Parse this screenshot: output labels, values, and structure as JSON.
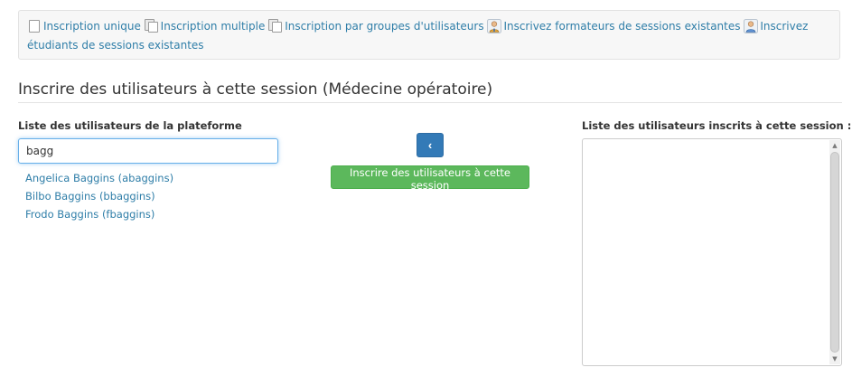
{
  "toolbar": {
    "links": [
      {
        "label": "Inscription unique",
        "icon": "single-user-document-icon"
      },
      {
        "label": "Inscription multiple",
        "icon": "multiple-documents-icon"
      },
      {
        "label": "Inscription par groupes d'utilisateurs",
        "icon": "group-documents-icon"
      },
      {
        "label": "Inscrivez formateurs de sessions existantes",
        "icon": "teacher-user-icon"
      },
      {
        "label": "Inscrivez étudiants de sessions existantes",
        "icon": "student-user-icon"
      }
    ]
  },
  "page": {
    "title": "Inscrire des utilisateurs à cette session (Médecine opératoire)"
  },
  "platform_users": {
    "label": "Liste des utilisateurs de la plateforme",
    "search_value": "bagg",
    "results": [
      "Angelica Baggins (abaggins)",
      "Bilbo Baggins (bbaggins)",
      "Frodo Baggins (fbaggins)"
    ]
  },
  "actions": {
    "remove_arrow": "‹",
    "enroll_label": "Inscrire des utilisateurs à cette session"
  },
  "session_users": {
    "label": "Liste des utilisateurs inscrits à cette session :",
    "items": []
  },
  "colors": {
    "link": "#2f7ea8",
    "primary": "#337ab7",
    "success": "#5cb85c",
    "focus": "#66afe9"
  }
}
